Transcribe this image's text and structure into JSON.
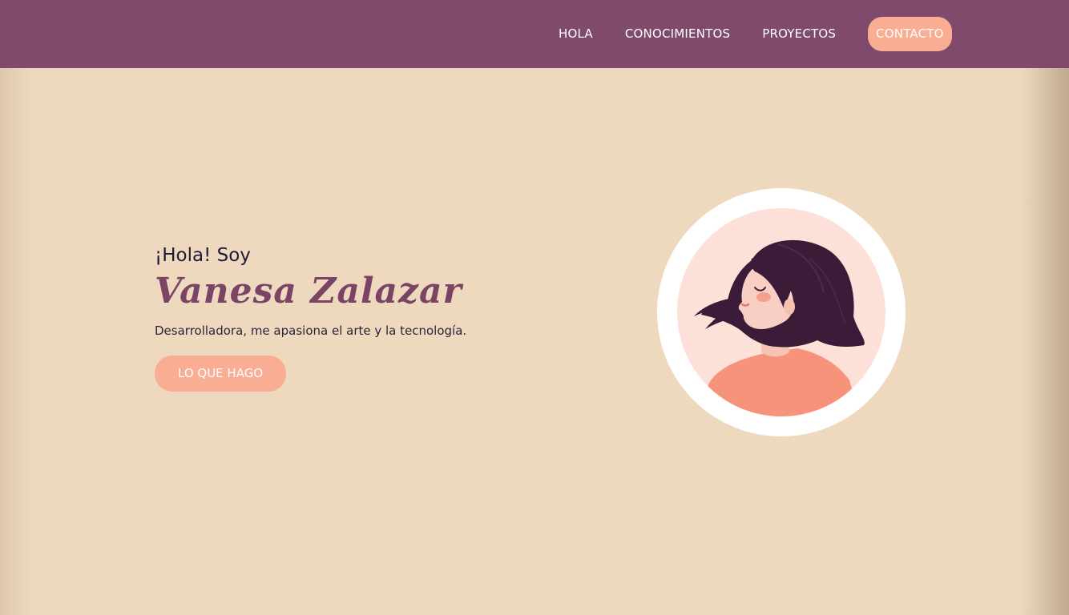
{
  "nav": {
    "items": [
      {
        "label": "HOLA"
      },
      {
        "label": "CONOCIMIENTOS"
      },
      {
        "label": "PROYECTOS"
      },
      {
        "label": "CONTACTO"
      }
    ]
  },
  "hero": {
    "greeting": "¡Hola! Soy",
    "name": "Vanesa Zalazar",
    "tagline": "Desarrolladora, me apasiona el arte y la tecnología.",
    "cta_label": "LO QUE HAGO",
    "avatar_icon": "woman-portrait-illustration"
  },
  "colors": {
    "header_bg": "#7f4a6b",
    "page_bg": "#eed9bf",
    "accent": "#f9ad92",
    "name_color": "#7a4465",
    "text_dark": "#1f1a35"
  }
}
